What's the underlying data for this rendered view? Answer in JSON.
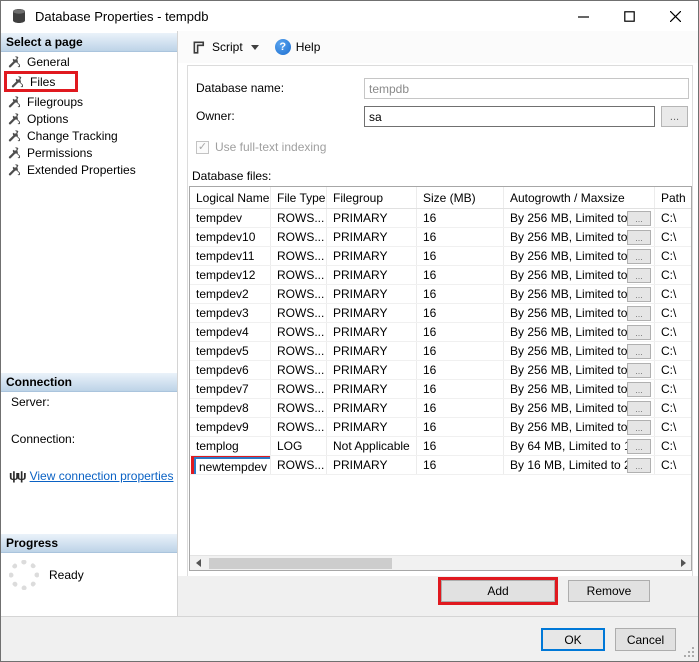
{
  "window": {
    "title": "Database Properties - tempdb"
  },
  "toolbar": {
    "script": "Script",
    "help": "Help"
  },
  "sidebar": {
    "select_page_header": "Select a page",
    "pages": [
      {
        "label": "General"
      },
      {
        "label": "Files",
        "highlighted": true
      },
      {
        "label": "Filegroups"
      },
      {
        "label": "Options"
      },
      {
        "label": "Change Tracking"
      },
      {
        "label": "Permissions"
      },
      {
        "label": "Extended Properties"
      }
    ],
    "connection_header": "Connection",
    "server_label": "Server:",
    "connection_label": "Connection:",
    "view_connection_link": "View connection properties",
    "progress_header": "Progress",
    "progress_status": "Ready"
  },
  "form": {
    "database_name_label": "Database name:",
    "database_name_value": "tempdb",
    "owner_label": "Owner:",
    "owner_value": "sa",
    "owner_browse": "...",
    "fulltext_checkbox_label": "Use full-text indexing",
    "database_files_label": "Database files:"
  },
  "files_table": {
    "columns": [
      "Logical Name",
      "File Type",
      "Filegroup",
      "Size (MB)",
      "Autogrowth / Maxsize",
      "Path"
    ],
    "rows": [
      {
        "name": "tempdev",
        "file_type": "ROWS...",
        "filegroup": "PRIMARY",
        "size": "16",
        "autogrowth": "By 256 MB, Limited to ...",
        "browse": "...",
        "path": "C:\\"
      },
      {
        "name": "tempdev10",
        "file_type": "ROWS...",
        "filegroup": "PRIMARY",
        "size": "16",
        "autogrowth": "By 256 MB, Limited to ...",
        "browse": "...",
        "path": "C:\\"
      },
      {
        "name": "tempdev11",
        "file_type": "ROWS...",
        "filegroup": "PRIMARY",
        "size": "16",
        "autogrowth": "By 256 MB, Limited to ...",
        "browse": "...",
        "path": "C:\\"
      },
      {
        "name": "tempdev12",
        "file_type": "ROWS...",
        "filegroup": "PRIMARY",
        "size": "16",
        "autogrowth": "By 256 MB, Limited to ...",
        "browse": "...",
        "path": "C:\\"
      },
      {
        "name": "tempdev2",
        "file_type": "ROWS...",
        "filegroup": "PRIMARY",
        "size": "16",
        "autogrowth": "By 256 MB, Limited to ...",
        "browse": "...",
        "path": "C:\\"
      },
      {
        "name": "tempdev3",
        "file_type": "ROWS...",
        "filegroup": "PRIMARY",
        "size": "16",
        "autogrowth": "By 256 MB, Limited to ...",
        "browse": "...",
        "path": "C:\\"
      },
      {
        "name": "tempdev4",
        "file_type": "ROWS...",
        "filegroup": "PRIMARY",
        "size": "16",
        "autogrowth": "By 256 MB, Limited to ...",
        "browse": "...",
        "path": "C:\\"
      },
      {
        "name": "tempdev5",
        "file_type": "ROWS...",
        "filegroup": "PRIMARY",
        "size": "16",
        "autogrowth": "By 256 MB, Limited to ...",
        "browse": "...",
        "path": "C:\\"
      },
      {
        "name": "tempdev6",
        "file_type": "ROWS...",
        "filegroup": "PRIMARY",
        "size": "16",
        "autogrowth": "By 256 MB, Limited to ...",
        "browse": "...",
        "path": "C:\\"
      },
      {
        "name": "tempdev7",
        "file_type": "ROWS...",
        "filegroup": "PRIMARY",
        "size": "16",
        "autogrowth": "By 256 MB, Limited to ...",
        "browse": "...",
        "path": "C:\\"
      },
      {
        "name": "tempdev8",
        "file_type": "ROWS...",
        "filegroup": "PRIMARY",
        "size": "16",
        "autogrowth": "By 256 MB, Limited to ...",
        "browse": "...",
        "path": "C:\\"
      },
      {
        "name": "tempdev9",
        "file_type": "ROWS...",
        "filegroup": "PRIMARY",
        "size": "16",
        "autogrowth": "By 256 MB, Limited to ...",
        "browse": "...",
        "path": "C:\\"
      },
      {
        "name": "templog",
        "file_type": "LOG",
        "filegroup": "Not Applicable",
        "size": "16",
        "autogrowth": "By 64 MB, Limited to 1...",
        "browse": "...",
        "path": "C:\\"
      },
      {
        "name": "newtempdev",
        "file_type": "ROWS...",
        "filegroup": "PRIMARY",
        "size": "16",
        "autogrowth": "By 16 MB, Limited to 2...",
        "browse": "...",
        "path": "C:\\",
        "editing": true
      }
    ]
  },
  "buttons": {
    "add": "Add",
    "remove": "Remove",
    "ok": "OK",
    "cancel": "Cancel"
  },
  "icons": {
    "help_glyph": "?",
    "check_glyph": "✓",
    "connection_glyph": "ψψ"
  },
  "colors": {
    "highlight_red": "#e0191f",
    "focus_blue": "#0078d7",
    "header_gradient_top": "#eaf2fa",
    "header_gradient_bottom": "#bdd3e7"
  }
}
